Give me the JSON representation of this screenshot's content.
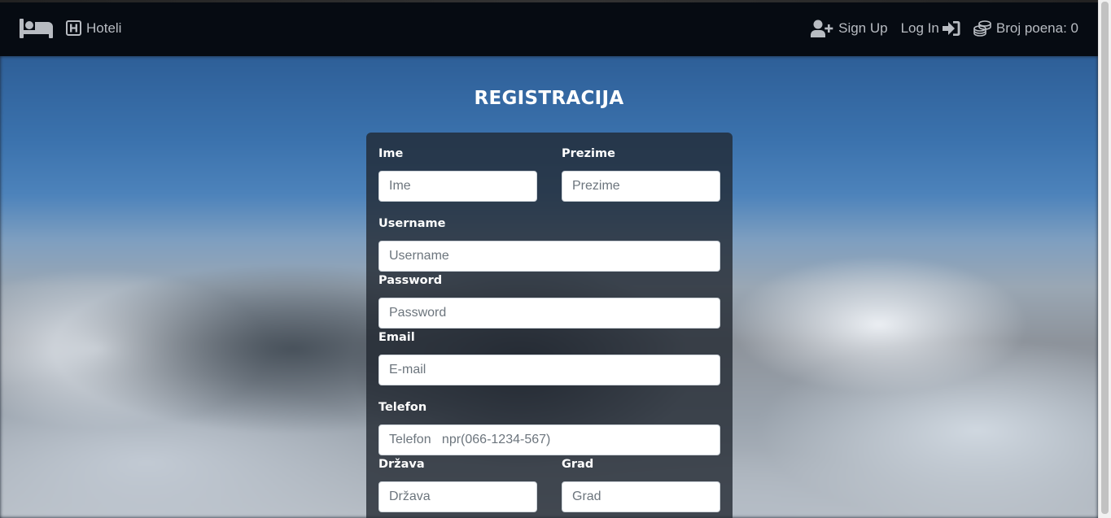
{
  "navbar": {
    "brand_icon": "bed-icon",
    "hotels_icon": "hotel-h-icon",
    "hotels_label": "Hoteli",
    "signup_icon": "user-plus-icon",
    "signup_label": "Sign Up",
    "login_label": "Log In",
    "login_icon": "sign-in-icon",
    "points_icon": "coins-icon",
    "points_label": "Broj poena: 0"
  },
  "form": {
    "title": "REGISTRACIJA",
    "ime_label": "Ime",
    "ime_placeholder": "Ime",
    "prezime_label": "Prezime",
    "prezime_placeholder": "Prezime",
    "username_label": "Username",
    "username_placeholder": "Username",
    "password_label": "Password",
    "password_placeholder": "Password",
    "email_label": "Email",
    "email_placeholder": "E-mail",
    "telefon_label": "Telefon",
    "telefon_placeholder": "Telefon   npr(066-1234-567)",
    "drzava_label": "Država",
    "drzava_placeholder": "Država",
    "grad_label": "Grad",
    "grad_placeholder": "Grad"
  },
  "colors": {
    "navbar_bg": "#060b12",
    "nav_text": "#b8bcc2",
    "card_bg": "rgba(32,38,48,0.78)",
    "label_text": "#ffffff"
  }
}
